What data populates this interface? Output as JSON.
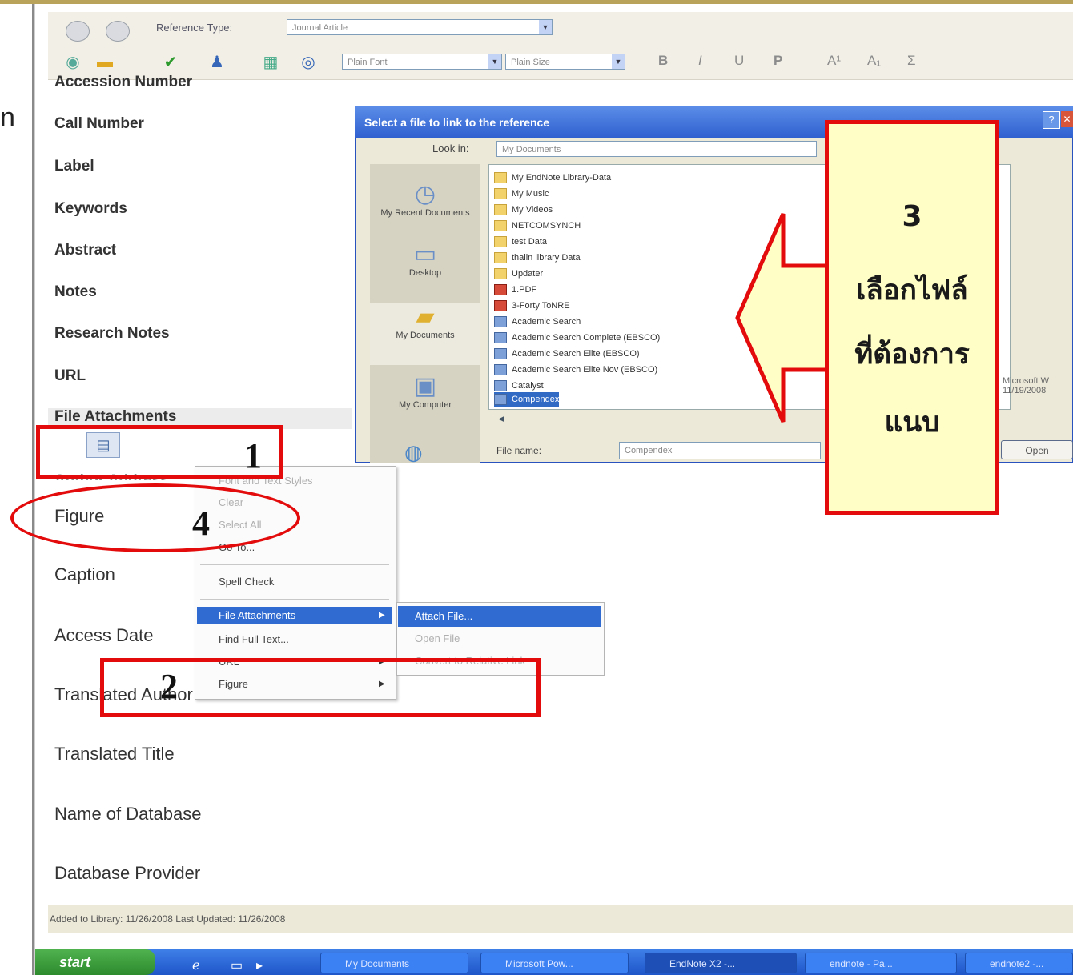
{
  "page_fragment": "n",
  "toolbar": {
    "ref_type_label": "Reference Type:",
    "ref_type_value": "Journal Article",
    "font_value": "Plain Font",
    "size_value": "Plain Size",
    "bold": "B",
    "italic": "I",
    "underline": "U",
    "plain": "P",
    "superscript": "A¹",
    "subscript": "A₁",
    "symbol": "Σ"
  },
  "fields": {
    "accession": "Accession Number",
    "call_number": "Call Number",
    "label": "Label",
    "keywords": "Keywords",
    "abstract": "Abstract",
    "notes": "Notes",
    "research_notes": "Research Notes",
    "url": "URL",
    "file_attachments": "File Attachments",
    "author_address": "Author Address",
    "figure": "Figure",
    "caption": "Caption",
    "access_date": "Access Date",
    "translated_author": "Translated Author",
    "translated_title": "Translated Title",
    "name_of_database": "Name of Database",
    "database_provider": "Database Provider"
  },
  "dialog": {
    "title": "Select a file to link to the reference",
    "look_in_label": "Look in:",
    "look_in_value": "My Documents",
    "places": [
      "My Recent Documents",
      "Desktop",
      "My Documents",
      "My Computer"
    ],
    "files": [
      "My EndNote Library-Data",
      "My Music",
      "My Videos",
      "NETCOMSYNCH",
      "test Data",
      "thaiin library Data",
      "Updater",
      "1.PDF",
      "3-Forty ToNRE",
      "Academic Search",
      "Academic Search Complete (EBSCO)",
      "Academic Search Elite (EBSCO)",
      "Academic Search Elite Nov (EBSCO)",
      "Catalyst",
      "Compendex"
    ],
    "file_name_label": "File name:",
    "file_name_value": "Compendex",
    "open_button": "Open",
    "right_info_1": "Microsoft W",
    "right_info_2": "11/19/2008"
  },
  "context_menu": {
    "items": [
      "Font and Text Styles",
      "Clear",
      "Select All",
      "Go To...",
      "Spell Check",
      "File Attachments",
      "Find Full Text...",
      "URL",
      "Figure"
    ],
    "submenu": [
      "Attach File...",
      "Open File",
      "Convert to Relative Link"
    ]
  },
  "callout": {
    "number": "3",
    "line1": "เลือกไฟล์",
    "line2": "ที่ต้องการ",
    "line3": "แนบ"
  },
  "steps": {
    "one": "1",
    "two": "2",
    "four": "4"
  },
  "status": {
    "text": "Added to Library: 11/26/2008   Last Updated: 11/26/2008"
  },
  "taskbar": {
    "start": "start",
    "buttons": [
      "My Documents",
      "Microsoft Pow...",
      "EndNote X2 -...",
      "endnote - Pa...",
      "endnote2 -..."
    ]
  },
  "colors": {
    "highlight_red": "#e30b0b",
    "callout_fill": "#fffec6",
    "selection_blue": "#2f6bd0",
    "title_blue": "#3a6fd8"
  }
}
